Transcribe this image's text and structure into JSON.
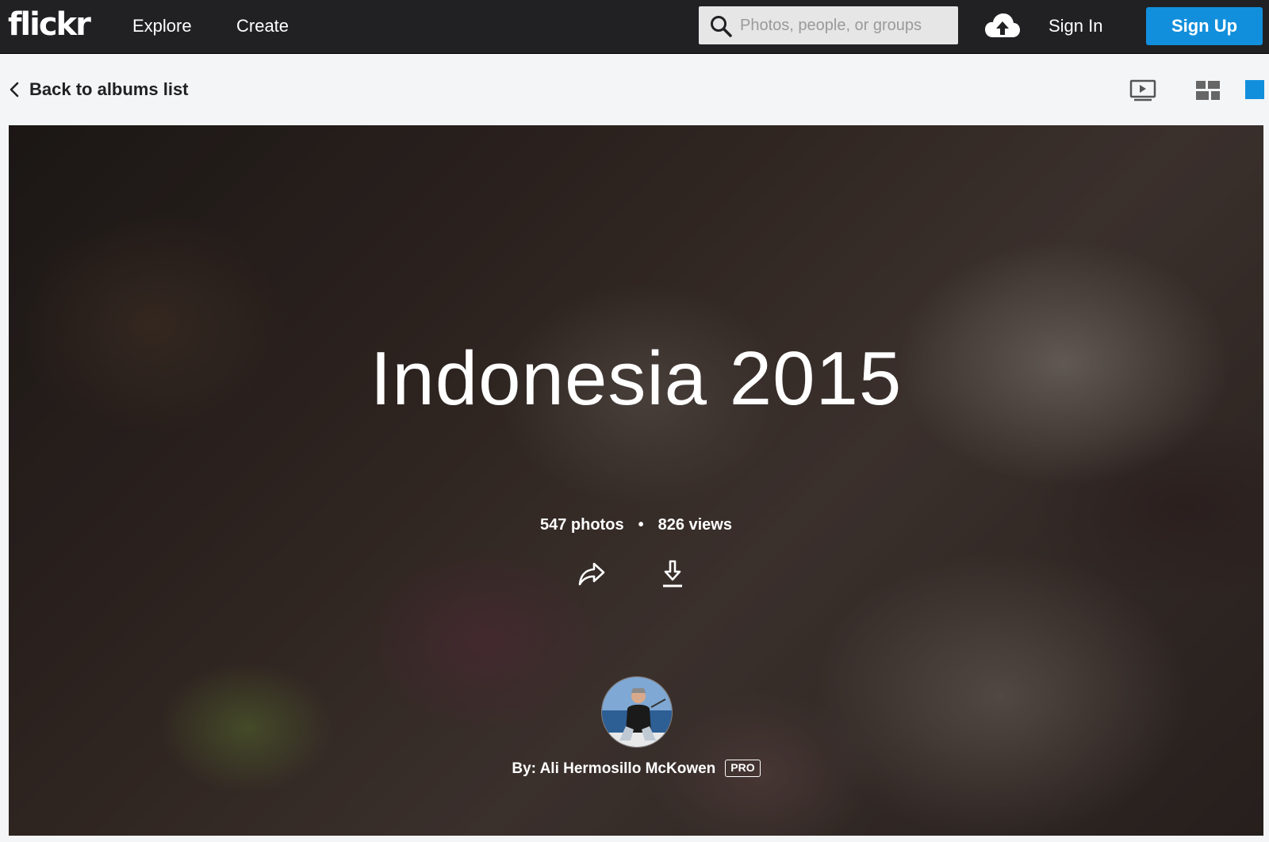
{
  "header": {
    "logo": "flickr",
    "nav": {
      "explore": "Explore",
      "create": "Create"
    },
    "search": {
      "placeholder": "Photos, people, or groups",
      "icon": "search-icon"
    },
    "upload_icon": "cloud-upload-icon",
    "sign_in": "Sign In",
    "sign_up": "Sign Up"
  },
  "subbar": {
    "back": "Back to albums list",
    "views": [
      "slideshow-icon",
      "grid-icon",
      "single-view-icon"
    ]
  },
  "album": {
    "title": "Indonesia 2015",
    "photos": "547 photos",
    "separator": "•",
    "views": "826 views",
    "byline": "By: Ali Hermosillo McKowen",
    "badge": "PRO"
  },
  "colors": {
    "nav_bg": "#212124",
    "accent": "#128fdc",
    "page_bg": "#f3f5f6",
    "text_dark": "#212124"
  }
}
